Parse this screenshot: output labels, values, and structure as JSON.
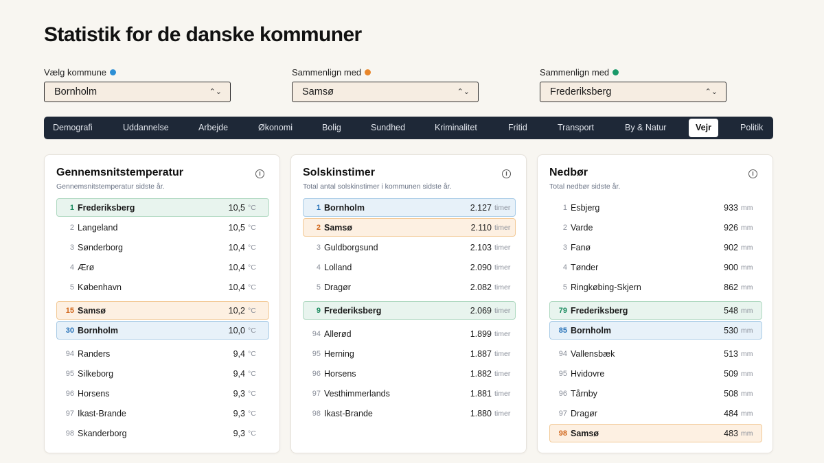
{
  "title": "Statistik for de danske kommuner",
  "selectors": [
    {
      "label": "Vælg kommune",
      "value": "Bornholm",
      "dot_color": "#2d8fd5"
    },
    {
      "label": "Sammenlign med",
      "value": "Samsø",
      "dot_color": "#e8862a"
    },
    {
      "label": "Sammenlign med",
      "value": "Frederiksberg",
      "dot_color": "#1a9a6a"
    }
  ],
  "tabs": [
    "Demografi",
    "Uddannelse",
    "Arbejde",
    "Økonomi",
    "Bolig",
    "Sundhed",
    "Kriminalitet",
    "Fritid",
    "Transport",
    "By & Natur",
    "Vejr",
    "Politik"
  ],
  "active_tab": "Vejr",
  "cards": [
    {
      "title": "Gennemsnitstemperatur",
      "subtitle": "Gennemsnitstemperatur sidste år.",
      "unit": "°C",
      "rows": [
        {
          "rank": "1",
          "name": "Frederiksberg",
          "value": "10,5",
          "hl": "green"
        },
        {
          "rank": "2",
          "name": "Langeland",
          "value": "10,5",
          "hl": ""
        },
        {
          "rank": "3",
          "name": "Sønderborg",
          "value": "10,4",
          "hl": ""
        },
        {
          "rank": "4",
          "name": "Ærø",
          "value": "10,4",
          "hl": ""
        },
        {
          "rank": "5",
          "name": "København",
          "value": "10,4",
          "hl": ""
        },
        {
          "rank": "15",
          "name": "Samsø",
          "value": "10,2",
          "hl": "orange"
        },
        {
          "rank": "30",
          "name": "Bornholm",
          "value": "10,0",
          "hl": "blue"
        },
        {
          "rank": "94",
          "name": "Randers",
          "value": "9,4",
          "hl": ""
        },
        {
          "rank": "95",
          "name": "Silkeborg",
          "value": "9,4",
          "hl": ""
        },
        {
          "rank": "96",
          "name": "Horsens",
          "value": "9,3",
          "hl": ""
        },
        {
          "rank": "97",
          "name": "Ikast-Brande",
          "value": "9,3",
          "hl": ""
        },
        {
          "rank": "98",
          "name": "Skanderborg",
          "value": "9,3",
          "hl": ""
        }
      ]
    },
    {
      "title": "Solskinstimer",
      "subtitle": "Total antal solskinstimer i kommunen sidste år.",
      "unit": "timer",
      "rows": [
        {
          "rank": "1",
          "name": "Bornholm",
          "value": "2.127",
          "hl": "blue"
        },
        {
          "rank": "2",
          "name": "Samsø",
          "value": "2.110",
          "hl": "orange"
        },
        {
          "rank": "3",
          "name": "Guldborgsund",
          "value": "2.103",
          "hl": ""
        },
        {
          "rank": "4",
          "name": "Lolland",
          "value": "2.090",
          "hl": ""
        },
        {
          "rank": "5",
          "name": "Dragør",
          "value": "2.082",
          "hl": ""
        },
        {
          "rank": "9",
          "name": "Frederiksberg",
          "value": "2.069",
          "hl": "green"
        },
        {
          "rank": "94",
          "name": "Allerød",
          "value": "1.899",
          "hl": ""
        },
        {
          "rank": "95",
          "name": "Herning",
          "value": "1.887",
          "hl": ""
        },
        {
          "rank": "96",
          "name": "Horsens",
          "value": "1.882",
          "hl": ""
        },
        {
          "rank": "97",
          "name": "Vesthimmerlands",
          "value": "1.881",
          "hl": ""
        },
        {
          "rank": "98",
          "name": "Ikast-Brande",
          "value": "1.880",
          "hl": ""
        }
      ]
    },
    {
      "title": "Nedbør",
      "subtitle": "Total nedbør sidste år.",
      "unit": "mm",
      "rows": [
        {
          "rank": "1",
          "name": "Esbjerg",
          "value": "933",
          "hl": ""
        },
        {
          "rank": "2",
          "name": "Varde",
          "value": "926",
          "hl": ""
        },
        {
          "rank": "3",
          "name": "Fanø",
          "value": "902",
          "hl": ""
        },
        {
          "rank": "4",
          "name": "Tønder",
          "value": "900",
          "hl": ""
        },
        {
          "rank": "5",
          "name": "Ringkøbing-Skjern",
          "value": "862",
          "hl": ""
        },
        {
          "rank": "79",
          "name": "Frederiksberg",
          "value": "548",
          "hl": "green"
        },
        {
          "rank": "85",
          "name": "Bornholm",
          "value": "530",
          "hl": "blue"
        },
        {
          "rank": "94",
          "name": "Vallensbæk",
          "value": "513",
          "hl": ""
        },
        {
          "rank": "95",
          "name": "Hvidovre",
          "value": "509",
          "hl": ""
        },
        {
          "rank": "96",
          "name": "Tårnby",
          "value": "508",
          "hl": ""
        },
        {
          "rank": "97",
          "name": "Dragør",
          "value": "484",
          "hl": ""
        },
        {
          "rank": "98",
          "name": "Samsø",
          "value": "483",
          "hl": "orange"
        }
      ]
    }
  ]
}
